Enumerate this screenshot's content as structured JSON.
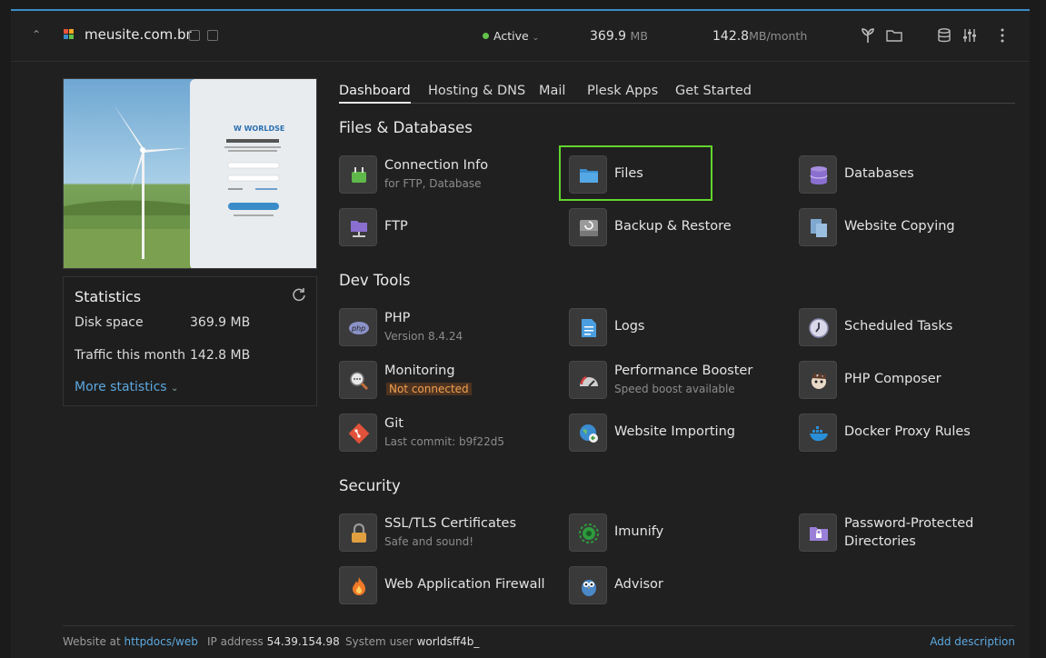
{
  "header": {
    "site_name": "meusite.com.br",
    "status": "Active",
    "disk_value": "369.9",
    "disk_unit": "MB",
    "traffic_value": "142.8",
    "traffic_unit": "MB/month"
  },
  "statistics": {
    "title": "Statistics",
    "rows": [
      {
        "label": "Disk space",
        "value": "369.9 MB"
      },
      {
        "label": "Traffic this month",
        "value": "142.8 MB"
      }
    ],
    "more_label": "More statistics"
  },
  "tabs": [
    "Dashboard",
    "Hosting & DNS",
    "Mail",
    "Plesk Apps",
    "Get Started"
  ],
  "sections": {
    "files_db": "Files & Databases",
    "dev_tools": "Dev Tools",
    "security": "Security"
  },
  "tools": {
    "connection_info": {
      "label": "Connection Info",
      "sub": "for FTP, Database"
    },
    "files": {
      "label": "Files"
    },
    "databases": {
      "label": "Databases"
    },
    "ftp": {
      "label": "FTP"
    },
    "backup": {
      "label": "Backup & Restore"
    },
    "website_copying": {
      "label": "Website Copying"
    },
    "php": {
      "label": "PHP",
      "sub": "Version 8.4.24"
    },
    "logs": {
      "label": "Logs"
    },
    "scheduled_tasks": {
      "label": "Scheduled Tasks"
    },
    "monitoring": {
      "label": "Monitoring",
      "badge": "Not connected"
    },
    "perf_booster": {
      "label": "Performance Booster",
      "sub": "Speed boost available"
    },
    "php_composer": {
      "label": "PHP Composer"
    },
    "git": {
      "label": "Git",
      "sub": "Last commit: b9f22d5"
    },
    "website_importing": {
      "label": "Website Importing"
    },
    "docker_proxy": {
      "label": "Docker Proxy Rules"
    },
    "ssl": {
      "label": "SSL/TLS Certificates",
      "sub": "Safe and sound!"
    },
    "imunify": {
      "label": "Imunify"
    },
    "pwd_dirs": {
      "label": "Password-Protected",
      "label2": "Directories"
    },
    "waf": {
      "label": "Web Application Firewall"
    },
    "advisor": {
      "label": "Advisor"
    }
  },
  "footer": {
    "website_at_label": "Website at",
    "website_at_value": "httpdocs/web",
    "ip_label": "IP address",
    "ip_value": "54.39.154.98",
    "user_label": "System user",
    "user_value": "worldsff4b_",
    "add_description": "Add description"
  },
  "colors": {
    "accent": "#3a8cc8",
    "highlight": "#62d62e",
    "link": "#5ca8e0",
    "active": "#62c14a"
  }
}
